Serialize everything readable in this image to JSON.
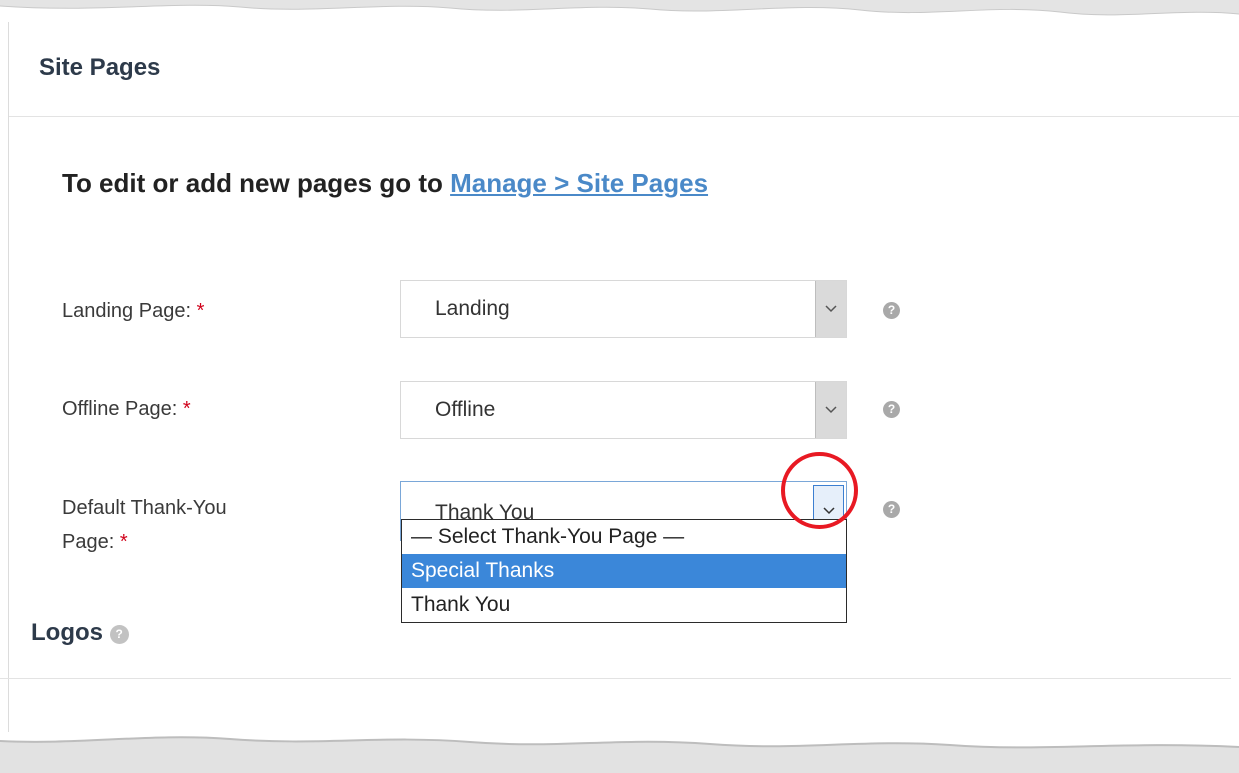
{
  "section": {
    "title": "Site Pages"
  },
  "info": {
    "text": "To edit or add new pages go to ",
    "link_label": "Manage > Site Pages"
  },
  "fields": {
    "landing": {
      "label": "Landing Page:",
      "required_mark": "*",
      "value": "Landing",
      "icon": "chevron-down-icon",
      "help_icon": "question-circle-icon"
    },
    "offline": {
      "label": "Offline Page:",
      "required_mark": "*",
      "value": "Offline",
      "icon": "chevron-down-icon",
      "help_icon": "question-circle-icon"
    },
    "thankyou": {
      "label_line1": "Default Thank-You",
      "label_line2": "Page:",
      "required_mark": "*",
      "value": "Thank You",
      "icon": "chevron-down-icon",
      "help_icon": "question-circle-icon",
      "options": [
        "— Select Thank-You Page —",
        "Special Thanks",
        "Thank You"
      ],
      "highlighted_option": "Special Thanks"
    }
  },
  "logos": {
    "title": "Logos",
    "help_icon": "question-circle-icon"
  },
  "colors": {
    "link": "#4a89c8",
    "required": "#d0021b",
    "option_highlight": "#3b87d9",
    "annotation_circle": "#e81923"
  }
}
